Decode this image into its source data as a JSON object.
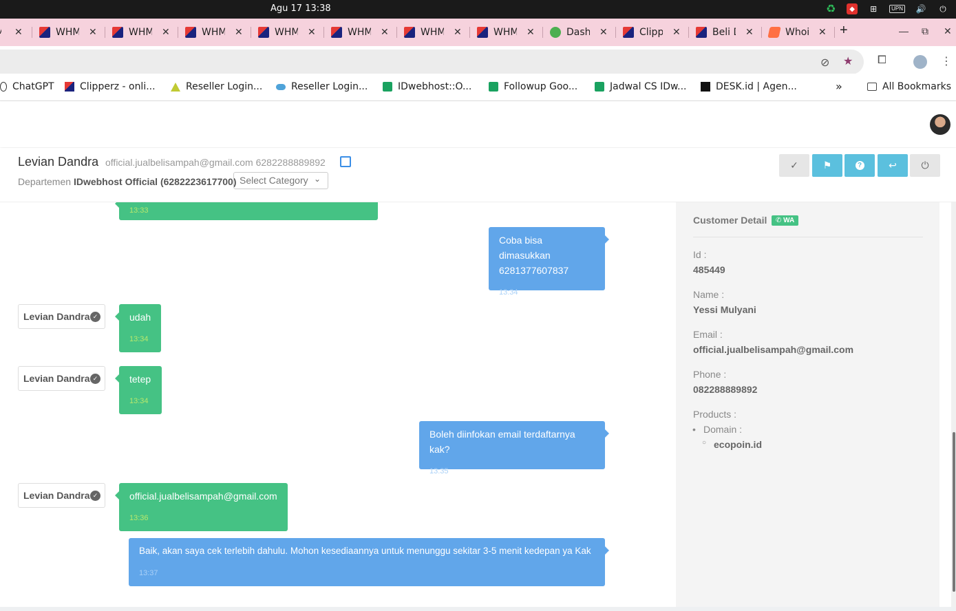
{
  "os": {
    "clock": "Agu 17  13:38",
    "tray_icons": [
      "recycle-icon",
      "anydesk-icon",
      "network-icon",
      "vpn-icon",
      "volume-icon",
      "power-icon"
    ],
    "upn_label": "UPN"
  },
  "tabs": [
    {
      "label": "WHM",
      "icon": "whm-favicon"
    },
    {
      "label": "WHM",
      "icon": "whm-favicon"
    },
    {
      "label": "WHM",
      "icon": "whm-favicon"
    },
    {
      "label": "WHM",
      "icon": "whm-favicon"
    },
    {
      "label": "WHM",
      "icon": "whm-favicon"
    },
    {
      "label": "WHM",
      "icon": "whm-favicon"
    },
    {
      "label": "WHM",
      "icon": "whm-favicon"
    },
    {
      "label": "Dash",
      "icon": "whatsapp-favicon"
    },
    {
      "label": "Clipp",
      "icon": "whm-favicon"
    },
    {
      "label": "Beli D",
      "icon": "whm-favicon"
    },
    {
      "label": "Whoi",
      "icon": "orange-favicon"
    }
  ],
  "bookmarks": [
    {
      "label": "ChatGPT",
      "icon": "chatgpt-icon"
    },
    {
      "label": "Clipperz - onli...",
      "icon": "whm-icon"
    },
    {
      "label": "Reseller Login...",
      "icon": "triangle-icon"
    },
    {
      "label": "Reseller Login...",
      "icon": "cloud-icon"
    },
    {
      "label": "IDwebhost::O...",
      "icon": "sheet-icon"
    },
    {
      "label": "Followup Goo...",
      "icon": "sheet-icon"
    },
    {
      "label": "Jadwal CS IDw...",
      "icon": "sheet-icon"
    },
    {
      "label": "DESK.id | Agen...",
      "icon": "desk-icon"
    }
  ],
  "bookmarks_more": "»",
  "all_bookmarks": "All Bookmarks",
  "ticket": {
    "customer_name": "Levian Dandra",
    "customer_contact": "official.jualbelisampah@gmail.com 6282288889892",
    "department_label": "Departemen",
    "department_value": "IDwebhost Official (6282223617700)",
    "category_placeholder": "Select Category"
  },
  "messages": [
    {
      "side": "customer",
      "sender": "",
      "text": "",
      "time": "13:33"
    },
    {
      "side": "agent",
      "sender": "",
      "text": "Coba bisa dimasukkan 6281377607837",
      "time": "13:34"
    },
    {
      "side": "customer",
      "sender": "Levian Dandra",
      "text": "udah",
      "time": "13:34"
    },
    {
      "side": "customer",
      "sender": "Levian Dandra",
      "text": "tetep",
      "time": "13:34"
    },
    {
      "side": "agent",
      "sender": "",
      "text": "Boleh diinfokan email terdaftarnya kak?",
      "time": "13:35"
    },
    {
      "side": "customer",
      "sender": "Levian Dandra",
      "text": "official.jualbelisampah@gmail.com",
      "time": "13:36"
    },
    {
      "side": "agent",
      "sender": "",
      "text": "Baik, akan saya cek terlebih dahulu. Mohon kesediaannya untuk menunggu sekitar 3-5 menit kedepan ya Kak",
      "time": "13:37"
    }
  ],
  "customer_detail": {
    "title": "Customer Detail",
    "badge": "WA",
    "id_label": "Id :",
    "id_value": "485449",
    "name_label": "Name :",
    "name_value": "Yessi Mulyani",
    "email_label": "Email :",
    "email_value": "official.jualbelisampah@gmail.com",
    "phone_label": "Phone :",
    "phone_value": "082288889892",
    "products_label": "Products :",
    "product_type": "Domain :",
    "product_domain": "ecopoin.id"
  },
  "colors": {
    "customer_bubble": "#45c284",
    "agent_bubble": "#61a6ea",
    "action_blue": "#5bc0de",
    "tabstrip": "#f6d2dd"
  }
}
